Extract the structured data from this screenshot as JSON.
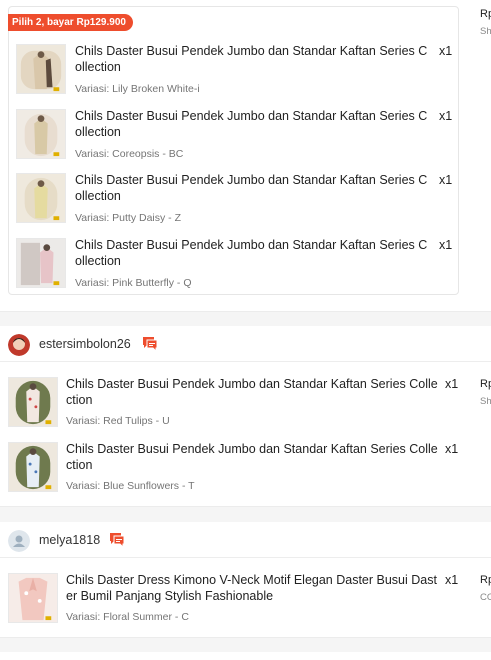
{
  "bundle": {
    "badge": "Pilih 2, bayar Rp129.900",
    "items": [
      {
        "title": "Chils Daster Busui Pendek Jumbo dan Standar Kaftan Series Collection",
        "variation": "Variasi: Lily Broken White-i",
        "qty": "x1"
      },
      {
        "title": "Chils Daster Busui Pendek Jumbo dan Standar Kaftan Series Collection",
        "variation": "Variasi: Coreopsis - BC",
        "qty": "x1"
      },
      {
        "title": "Chils Daster Busui Pendek Jumbo dan Standar Kaftan Series Collection",
        "variation": "Variasi: Putty Daisy - Z",
        "qty": "x1"
      },
      {
        "title": "Chils Daster Busui Pendek Jumbo dan Standar Kaftan Series Collection",
        "variation": "Variasi: Pink Butterfly - Q",
        "qty": "x1"
      }
    ]
  },
  "orders": [
    {
      "right_top": "Rp",
      "right_sub": "Sh"
    },
    {
      "buyer": "estersimbolon26",
      "right_top": "Rp",
      "right_sub": "Sh",
      "items": [
        {
          "title": "Chils Daster Busui Pendek Jumbo dan Standar Kaftan Series Collection",
          "variation": "Variasi: Red Tulips - U",
          "qty": "x1"
        },
        {
          "title": "Chils Daster Busui Pendek Jumbo dan Standar Kaftan Series Collection",
          "variation": "Variasi: Blue Sunflowers - T",
          "qty": "x1"
        }
      ]
    },
    {
      "buyer": "melya1818",
      "right_top": "Rp",
      "right_sub": "CO",
      "items": [
        {
          "title": "Chils Daster Dress Kimono V-Neck Motif Elegan Daster Busui Daster Bumil Panjang Stylish Fashionable",
          "variation": "Variasi: Floral Summer - C",
          "qty": "x1"
        }
      ]
    }
  ],
  "colors": {
    "accent": "#ee4d2d",
    "muted": "#757575",
    "border": "#e6e6e6"
  },
  "icons": {
    "chat": "chat-bubble-icon",
    "avatar_default": "user-icon"
  }
}
